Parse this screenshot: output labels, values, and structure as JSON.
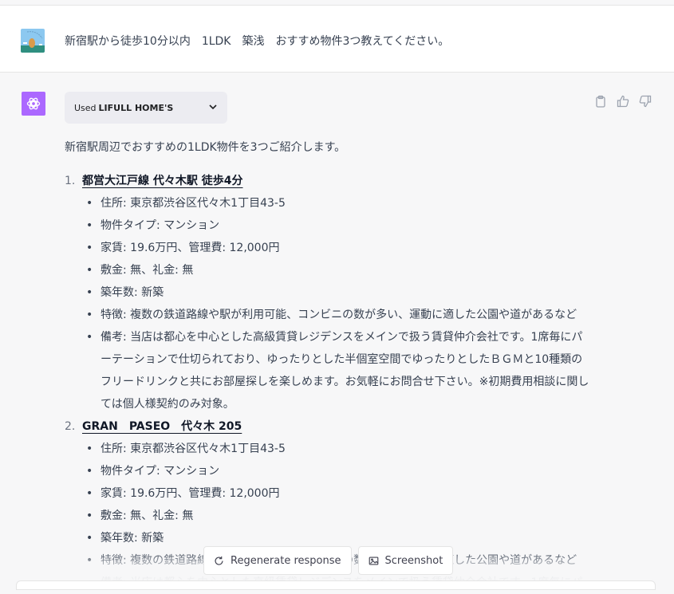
{
  "user_message": {
    "text": "新宿駅から徒歩10分以内　1LDK　築浅　おすすめ物件3つ教えてください。",
    "avatar_icon": "user-avatar-image"
  },
  "assistant": {
    "avatar_icon": "openai-logo-icon",
    "plugin": {
      "used_label": "Used",
      "plugin_name": "LIFULL HOME'S",
      "chevron_icon": "chevron-down-icon"
    },
    "action_icons": [
      "clipboard-icon",
      "thumbs-up-icon",
      "thumbs-down-icon"
    ],
    "intro": "新宿駅周辺でおすすめの1LDK物件を3つご紹介します。",
    "items": [
      {
        "number": "1.",
        "title": "都営大江戸線 代々木駅 徒歩4分",
        "details": [
          "住所: 東京都渋谷区代々木1丁目43-5",
          "物件タイプ: マンション",
          "家賃: 19.6万円、管理費: 12,000円",
          "敷金: 無、礼金: 無",
          "築年数: 新築",
          "特徴: 複数の鉄道路線や駅が利用可能、コンビニの数が多い、運動に適した公園や道があるなど",
          "備考: 当店は都心を中心とした高級賃貸レジデンスをメインで扱う賃貸仲介会社です。1席毎にパーテーションで仕切られており、ゆったりとした半個室空間でゆったりとしたＢＧＭと10種類のフリードリンクと共にお部屋探しを楽しめます。お気軽にお問合せ下さい。※初期費用相談に関しては個人様契約のみ対象。"
        ]
      },
      {
        "number": "2.",
        "title": "GRAN　PASEO　代々木 205",
        "details": [
          "住所: 東京都渋谷区代々木1丁目43-5",
          "物件タイプ: マンション",
          "家賃: 19.6万円、管理費: 12,000円",
          "敷金: 無、礼金: 無",
          "築年数: 新築",
          "特徴: 複数の鉄道路線や駅が利用可能、コンビニの数が多い、運動に適した公園や道があるなど",
          "備考: 当店は都心を中心とした高級賃貸レジデンスをメインで扱う賃貸仲介会社です。1席毎にパ"
        ]
      }
    ]
  },
  "bottom_buttons": {
    "regenerate": {
      "label": "Regenerate response",
      "icon": "refresh-icon"
    },
    "screenshot": {
      "label": "Screenshot",
      "icon": "image-icon"
    }
  }
}
